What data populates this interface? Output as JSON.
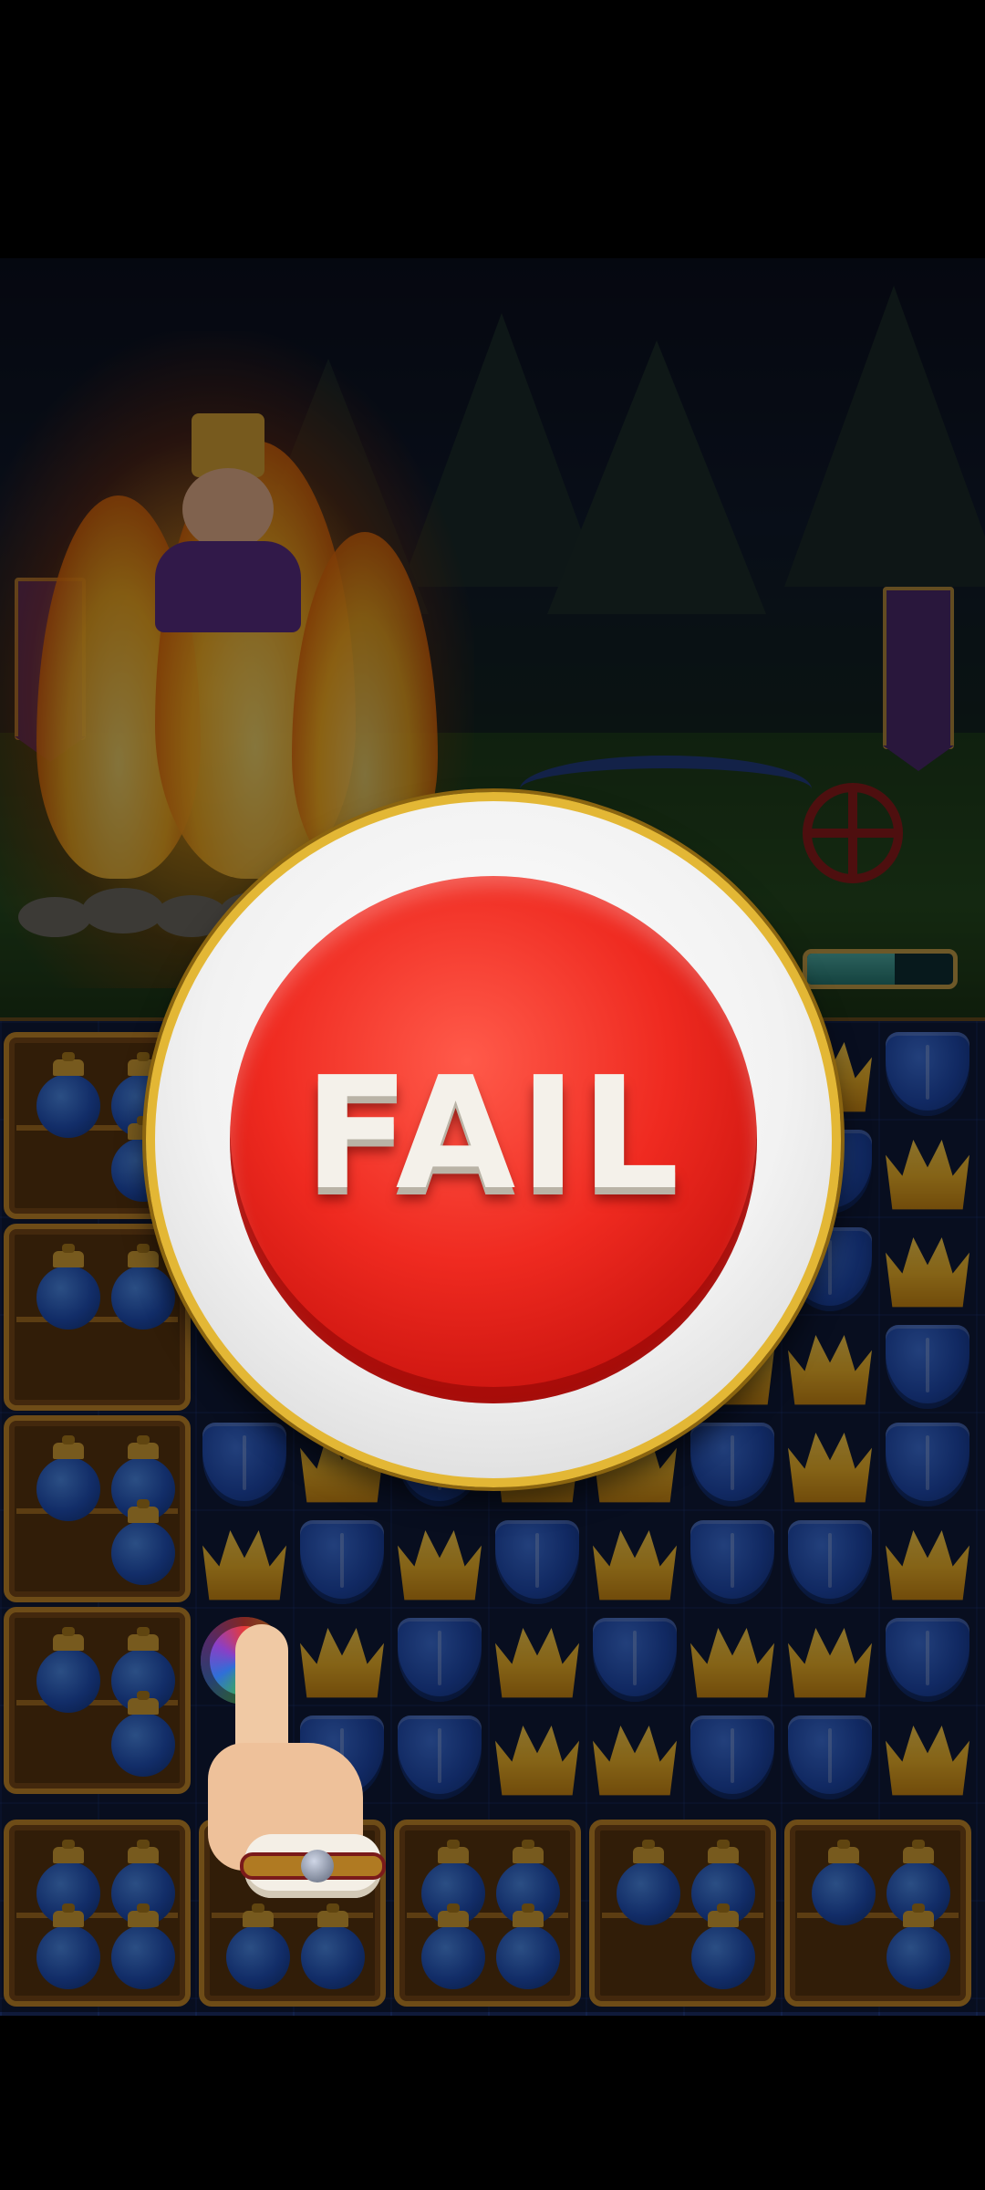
{
  "game": {
    "result_text": "FAIL",
    "progress_fraction": 0.6
  },
  "colors": {
    "fail_button": "#ef2a20",
    "badge_ring": "#e3b735",
    "shield_piece": "#1f4bb3",
    "crown_piece": "#f2b52a",
    "crate": "#c98a2a"
  },
  "icons": {
    "badge": "fail-badge",
    "pieces": [
      "shield-piece-icon",
      "crown-piece-icon",
      "honey-pot-icon",
      "rainbow-bomb-icon"
    ],
    "hint": "tap-hand-icon"
  }
}
